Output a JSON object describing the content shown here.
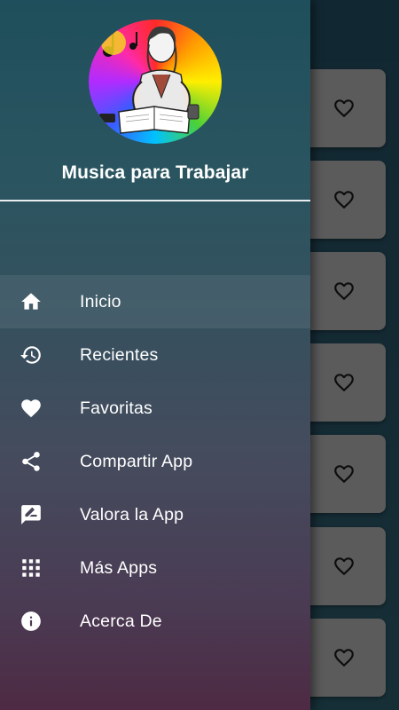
{
  "app": {
    "title": "Musica para Trabajar"
  },
  "drawer": {
    "items": [
      {
        "label": "Inicio",
        "icon": "home-icon",
        "active": true
      },
      {
        "label": "Recientes",
        "icon": "history-icon",
        "active": false
      },
      {
        "label": "Favoritas",
        "icon": "heart-icon",
        "active": false
      },
      {
        "label": "Compartir App",
        "icon": "share-icon",
        "active": false
      },
      {
        "label": "Valora la App",
        "icon": "rate-review-icon",
        "active": false
      },
      {
        "label": "Más Apps",
        "icon": "apps-grid-icon",
        "active": false
      },
      {
        "label": "Acerca De",
        "icon": "info-icon",
        "active": false
      }
    ]
  },
  "background_list": {
    "cards": [
      {
        "icon": "heart-outline-icon"
      },
      {
        "icon": "heart-outline-icon"
      },
      {
        "icon": "heart-outline-icon"
      },
      {
        "icon": "heart-outline-icon"
      },
      {
        "icon": "heart-outline-icon"
      },
      {
        "icon": "heart-outline-icon"
      },
      {
        "icon": "heart-outline-icon"
      }
    ]
  },
  "colors": {
    "drawer_top": "#1f4f5c",
    "drawer_bottom": "#4e2a44",
    "card": "#6f6f6f",
    "text": "#ffffff"
  }
}
